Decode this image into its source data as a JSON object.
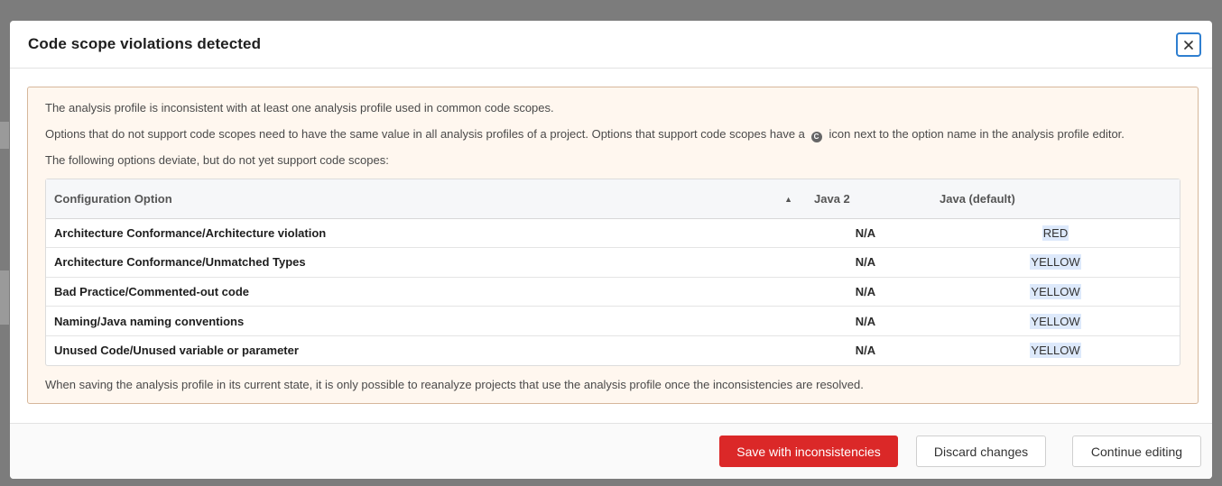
{
  "dialog": {
    "title": "Code scope violations detected"
  },
  "warning": {
    "line1": "The analysis profile is inconsistent with at least one analysis profile used in common code scopes.",
    "line2_before": "Options that do not support code scopes need to have the same value in all analysis profiles of a project. Options that support code scopes have a",
    "line2_icon": "code-scope-icon",
    "line2_after": "icon next to the option name in the analysis profile editor.",
    "line3": "The following options deviate, but do not yet support code scopes:",
    "footer": "When saving the analysis profile in its current state, it is only possible to reanalyze projects that use the analysis profile once the inconsistencies are resolved."
  },
  "table": {
    "headers": {
      "option": "Configuration Option",
      "java2": "Java 2",
      "java_default": "Java (default)"
    },
    "sort_icon": "sort-ascending-icon",
    "rows": [
      {
        "option": "Architecture Conformance/Architecture violation",
        "java2": "N/A",
        "java_default": "RED"
      },
      {
        "option": "Architecture Conformance/Unmatched Types",
        "java2": "N/A",
        "java_default": "YELLOW"
      },
      {
        "option": "Bad Practice/Commented-out code",
        "java2": "N/A",
        "java_default": "YELLOW"
      },
      {
        "option": "Naming/Java naming conventions",
        "java2": "N/A",
        "java_default": "YELLOW"
      },
      {
        "option": "Unused Code/Unused variable or parameter",
        "java2": "N/A",
        "java_default": "YELLOW"
      }
    ]
  },
  "buttons": {
    "save": "Save with inconsistencies",
    "discard": "Discard changes",
    "continue": "Continue editing"
  },
  "colors": {
    "primary_button": "#db2828",
    "warning_bg": "#fff7ef",
    "close_border": "#2f7fd0",
    "value_highlight": "#dde9fb"
  }
}
